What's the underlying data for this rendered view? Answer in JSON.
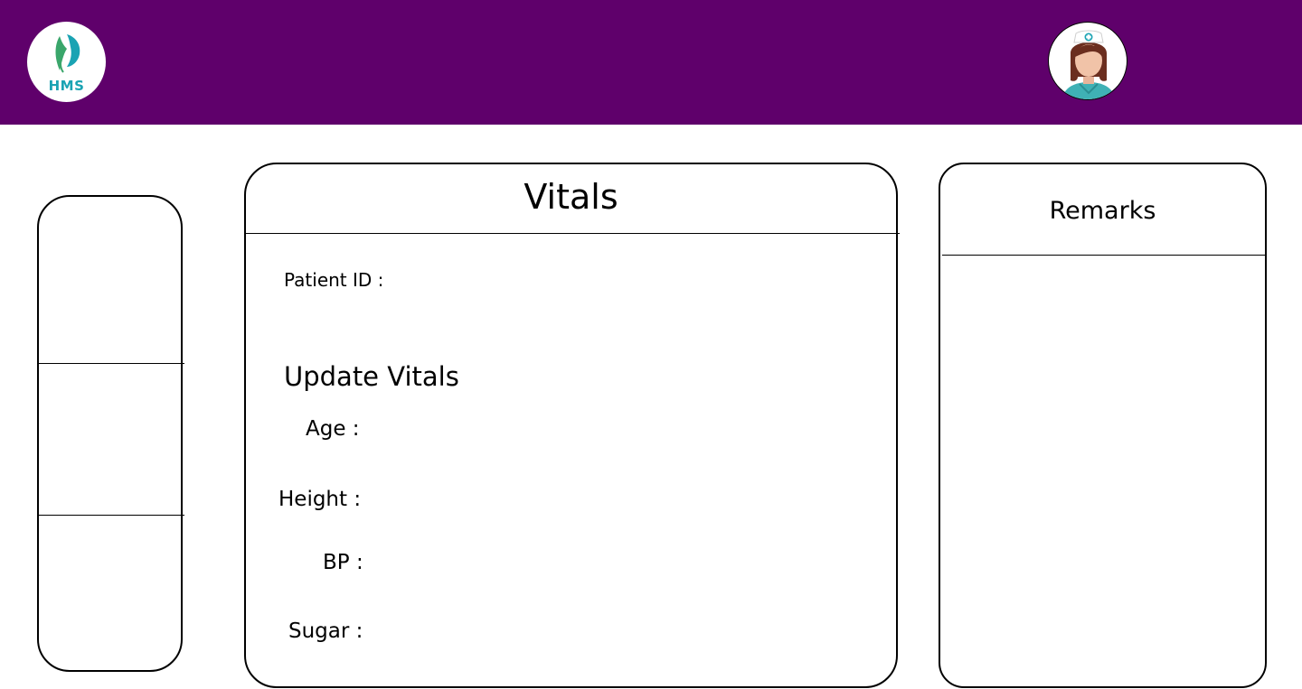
{
  "header": {
    "background_color": "#5f006b",
    "logo": {
      "text": "HMS",
      "icon": "hms-logo-icon",
      "color": "#1aa3b3"
    },
    "avatar": {
      "icon": "nurse-avatar-icon"
    }
  },
  "sidebar": {
    "sections": 3
  },
  "vitals_card": {
    "title": "Vitals",
    "patient_id_label": "Patient ID :",
    "update_heading": "Update Vitals",
    "fields": {
      "age": "Age :",
      "height": "Height :",
      "bp": "BP :",
      "sugar": "Sugar :"
    }
  },
  "remarks_card": {
    "title": "Remarks"
  }
}
